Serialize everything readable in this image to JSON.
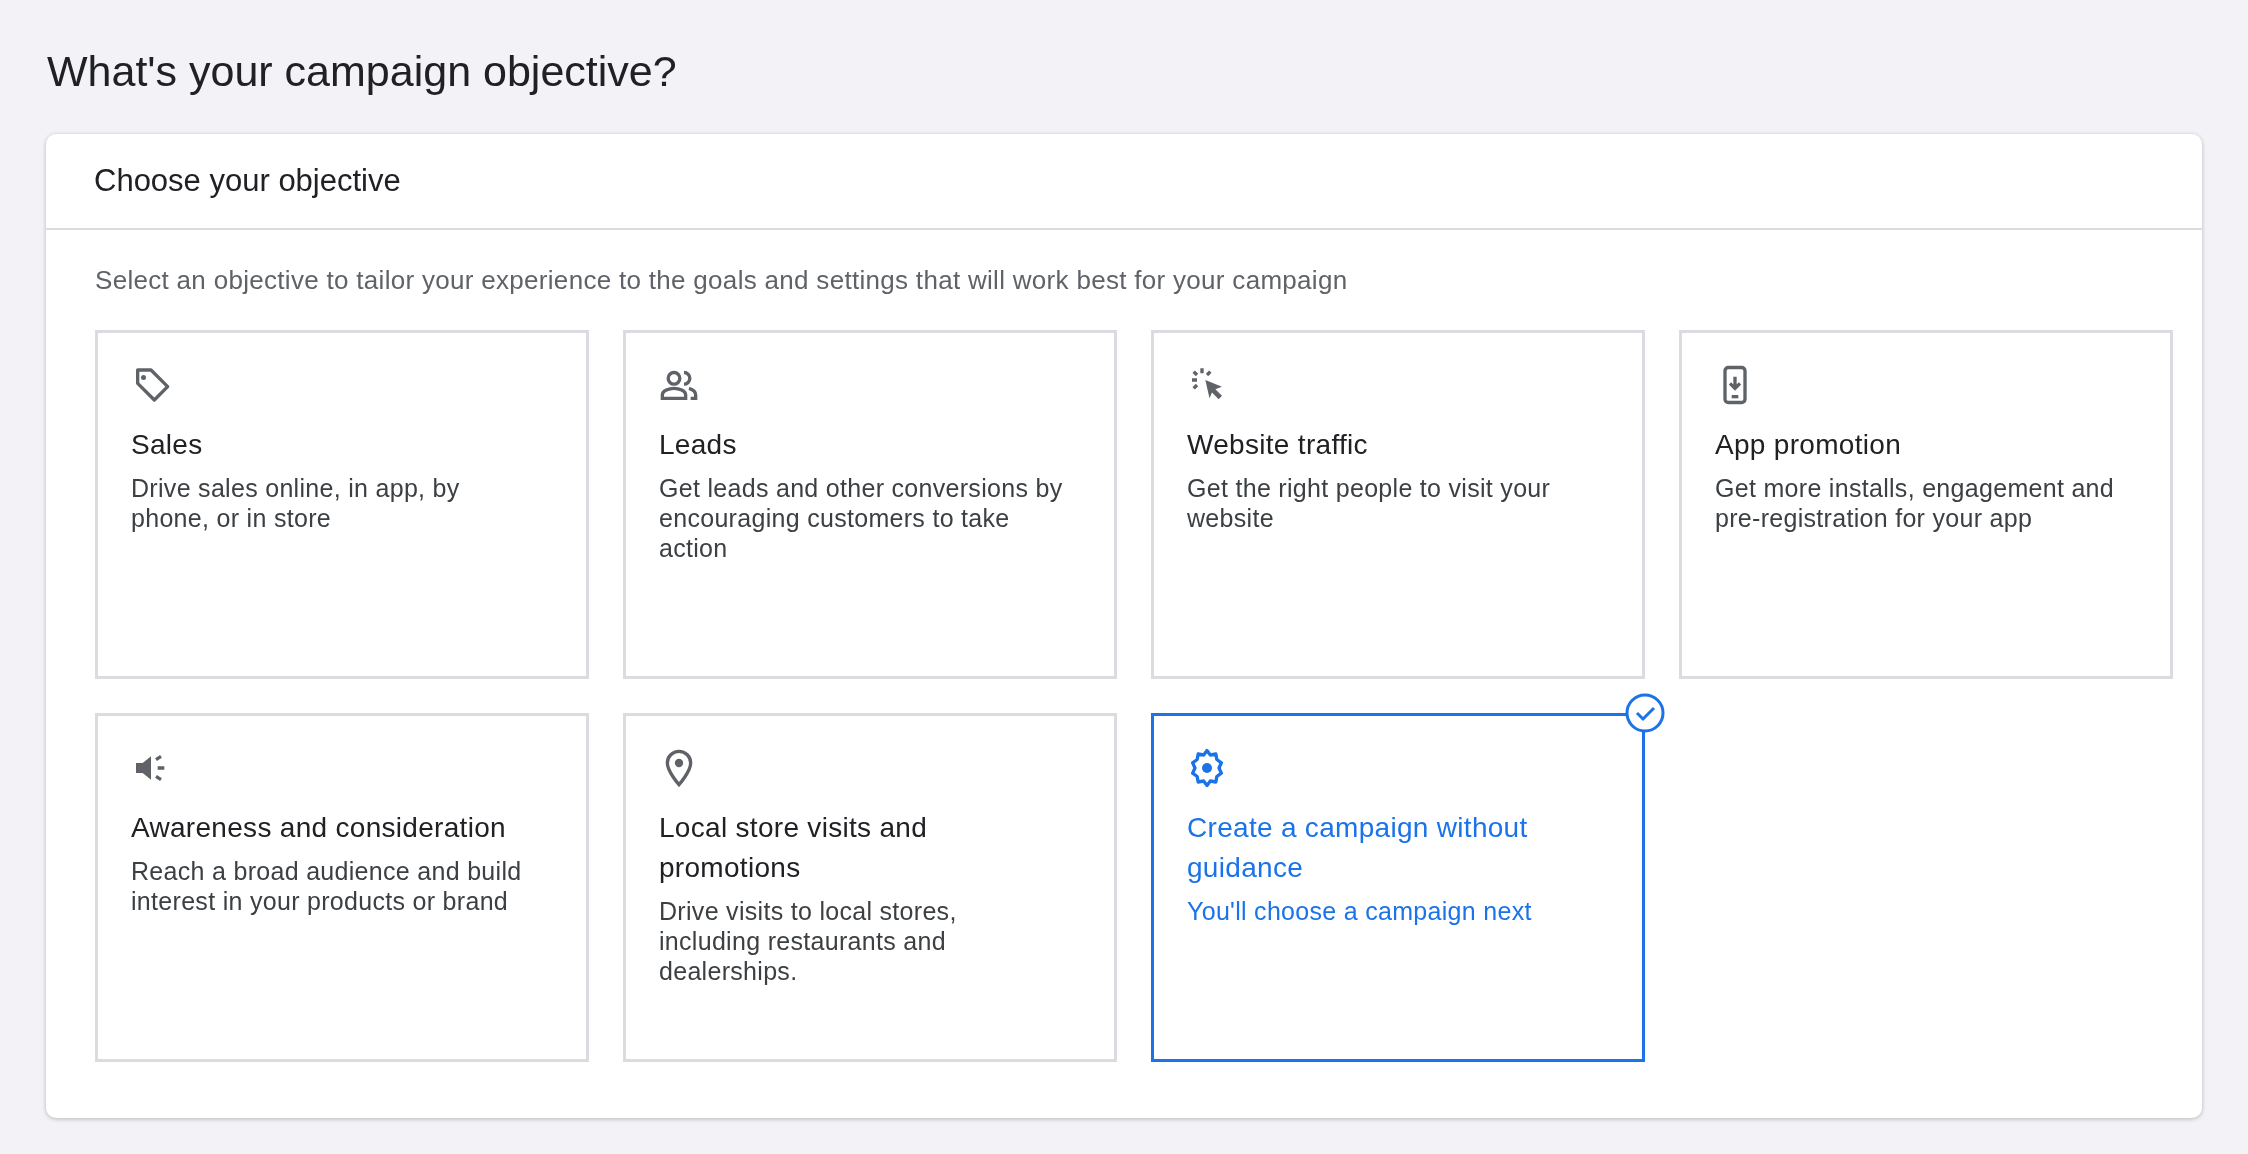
{
  "page_title": "What's your campaign objective?",
  "panel": {
    "title": "Choose your objective",
    "description": "Select an objective to tailor your experience to the goals and settings that will work best for your campaign",
    "objectives": [
      {
        "title": "Sales",
        "description": "Drive sales online, in app, by phone, or in store",
        "selected": false
      },
      {
        "title": "Leads",
        "description": "Get leads and other conversions by encouraging customers to take action",
        "selected": false
      },
      {
        "title": "Website traffic",
        "description": "Get the right people to visit your website",
        "selected": false
      },
      {
        "title": "App promotion",
        "description": "Get more installs, engagement and pre-registration for your app",
        "selected": false
      },
      {
        "title": "Awareness and consideration",
        "description": "Reach a broad audience and build interest in your products or brand",
        "selected": false
      },
      {
        "title": "Local store visits and promotions",
        "description": "Drive visits to local stores, including restaurants and dealerships.",
        "selected": false
      },
      {
        "title": "Create a campaign without guidance",
        "description": "You'll choose a campaign next",
        "selected": true
      }
    ]
  }
}
